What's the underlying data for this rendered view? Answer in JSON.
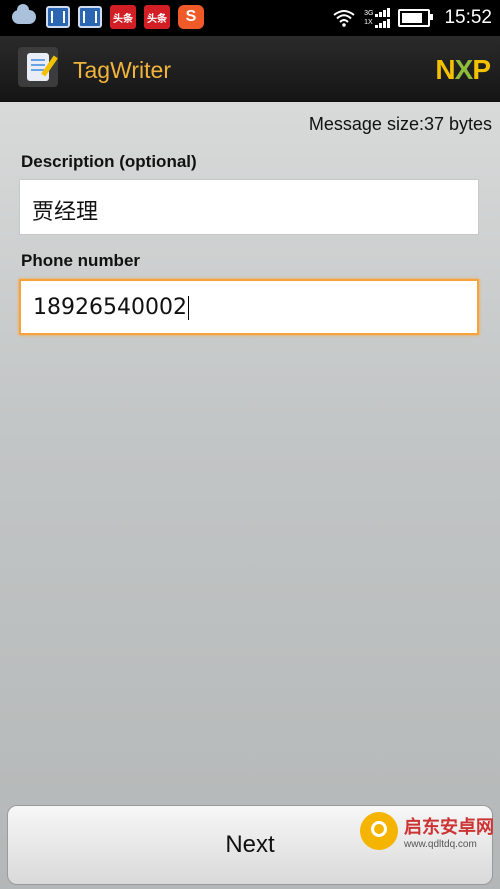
{
  "status_bar": {
    "net_top": "3G",
    "net_bottom": "1X",
    "time": "15:52",
    "notif_icons": [
      "weather-icon",
      "film-icon",
      "film-icon",
      "toutiao-icon",
      "toutiao-icon",
      "sogou-icon"
    ],
    "toutiao_text": "头条",
    "sogou_text": "S"
  },
  "action_bar": {
    "title": "TagWriter",
    "brand_n": "N",
    "brand_x": "X",
    "brand_p": "P"
  },
  "form": {
    "message_size": "Message size:37 bytes",
    "description_label": "Description (optional)",
    "description_value": "贾经理",
    "phone_label": "Phone number",
    "phone_value": "18926540002"
  },
  "buttons": {
    "next": "Next"
  },
  "watermark": {
    "line1": "启东安卓网",
    "line2": "www.qdltdq.com"
  },
  "colors": {
    "title": "#f0b43c",
    "focus_border": "#f7a23b"
  }
}
